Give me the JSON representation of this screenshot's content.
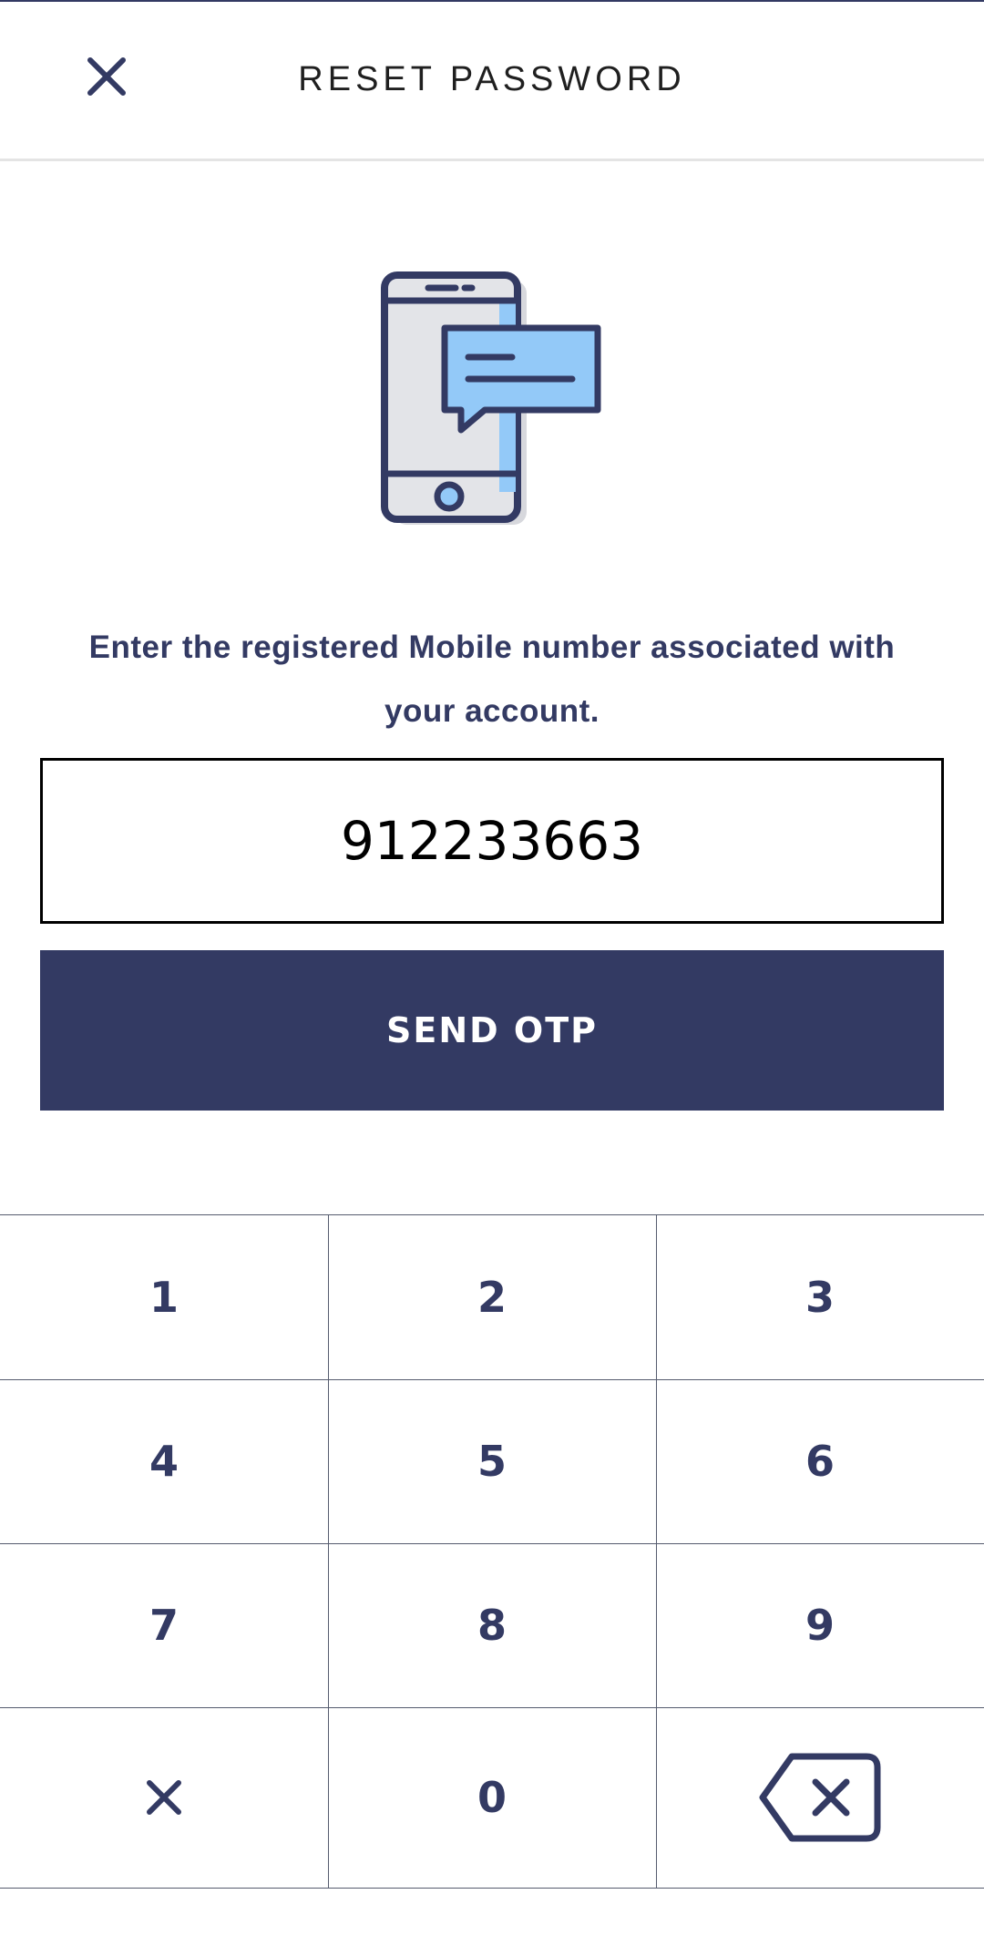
{
  "header": {
    "title": "RESET PASSWORD",
    "close_icon": "close-icon"
  },
  "illustration": {
    "icon": "phone-message-icon",
    "colors": {
      "outline": "#333a63",
      "screen": "#e3e4e8",
      "accent": "#93c9f8"
    }
  },
  "instruction": {
    "line1": "Enter the registered Mobile number associated with",
    "line2": "your account."
  },
  "phone_input": {
    "value": "912233663"
  },
  "send_button": {
    "label": "SEND OTP"
  },
  "keypad": {
    "keys": [
      "1",
      "2",
      "3",
      "4",
      "5",
      "6",
      "7",
      "8",
      "9",
      "0"
    ],
    "clear_icon": "close-icon",
    "backspace_icon": "backspace-icon"
  },
  "colors": {
    "primary": "#333a63",
    "button_text": "#ffffff"
  }
}
